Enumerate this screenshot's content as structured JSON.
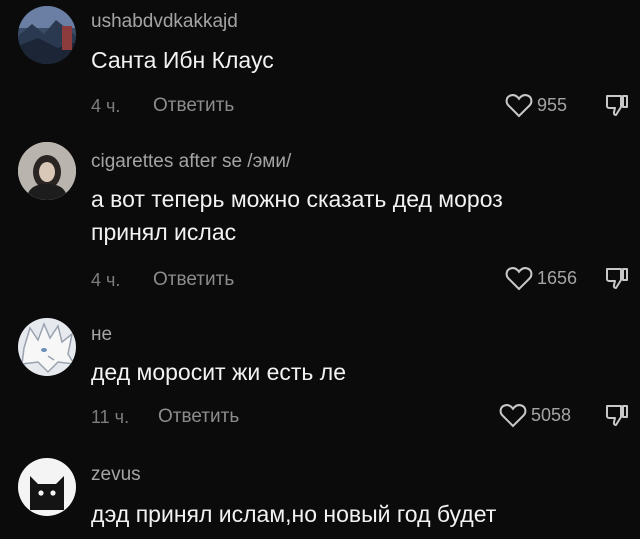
{
  "comments": [
    {
      "username": "ushabdvdkakkajd",
      "text": "Санта Ибн Клаус",
      "time": "4 ч.",
      "reply": "Ответить",
      "likes": "955",
      "avatar_icon": "landscape-avatar-icon"
    },
    {
      "username": "cigarettes after se /эми/",
      "text": "а вот теперь можно сказать дед мороз принял ислас",
      "time": "4 ч.",
      "reply": "Ответить",
      "likes": "1656",
      "avatar_icon": "person-avatar-icon"
    },
    {
      "username": "не",
      "text": "дед моросит жи есть ле",
      "time": "11 ч.",
      "reply": "Ответить",
      "likes": "5058",
      "avatar_icon": "anime-avatar-icon"
    },
    {
      "username": "zevus",
      "text": "дэд принял ислам,но новый год будет",
      "avatar_icon": "cat-avatar-icon"
    }
  ],
  "icons": {
    "like": "heart-outline-icon",
    "dislike": "thumbs-down-icon"
  },
  "colors": {
    "background": "#0b0b0b",
    "text": "#f2f2f2",
    "muted": "#8c8c8c"
  }
}
